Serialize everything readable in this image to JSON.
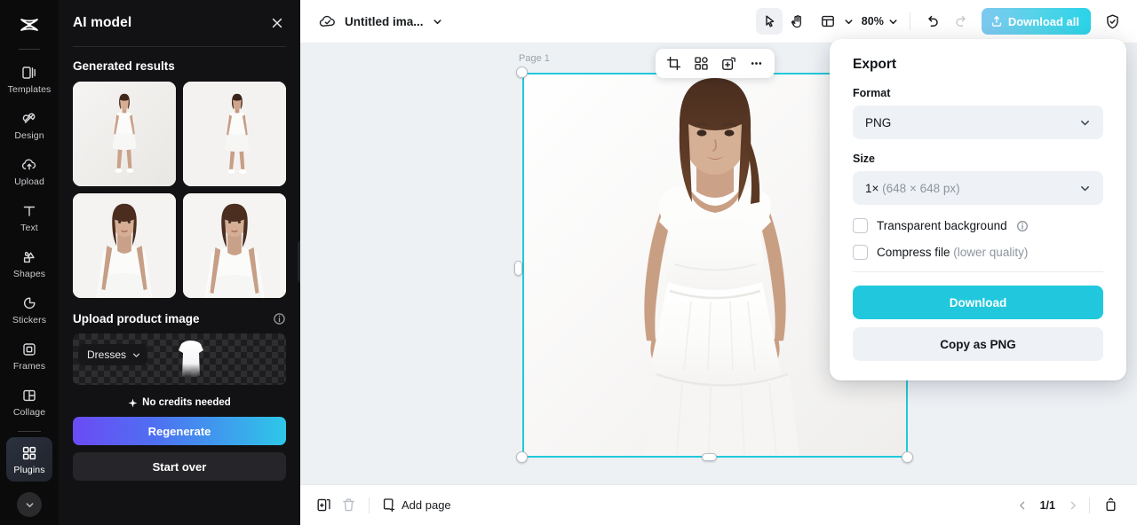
{
  "rail": {
    "logo_icon": "capcut-logo-icon",
    "items": [
      {
        "label": "Templates",
        "icon": "templates-icon",
        "active": false
      },
      {
        "label": "Design",
        "icon": "design-icon",
        "active": false
      },
      {
        "label": "Upload",
        "icon": "upload-cloud-icon",
        "active": false
      },
      {
        "label": "Text",
        "icon": "text-icon",
        "active": false
      },
      {
        "label": "Shapes",
        "icon": "shapes-icon",
        "active": false
      },
      {
        "label": "Stickers",
        "icon": "stickers-icon",
        "active": false
      },
      {
        "label": "Frames",
        "icon": "frames-icon",
        "active": false
      },
      {
        "label": "Collage",
        "icon": "collage-icon",
        "active": false
      },
      {
        "label": "Plugins",
        "icon": "plugins-icon",
        "active": true
      }
    ],
    "more_icon": "chevron-down-icon"
  },
  "panel": {
    "title": "AI model",
    "close_icon": "close-icon",
    "generated": {
      "heading": "Generated results",
      "count": 4
    },
    "upload": {
      "heading": "Upload product image",
      "info_icon": "info-icon",
      "category": "Dresses",
      "category_caret_icon": "chevron-down-icon"
    },
    "credits_text": "No credits needed",
    "credits_icon": "sparkle-icon",
    "regenerate_label": "Regenerate",
    "start_over_label": "Start over",
    "collapse_icon": "chevron-left-icon"
  },
  "topbar": {
    "cloud_icon": "cloud-saved-icon",
    "doc_name": "Untitled ima...",
    "doc_caret_icon": "chevron-down-icon",
    "select_tool_icon": "cursor-arrow-icon",
    "hand_tool_icon": "hand-icon",
    "layout_tool_icon": "layout-icon",
    "layout_caret_icon": "chevron-down-icon",
    "zoom_value": "80%",
    "zoom_caret_icon": "chevron-down-icon",
    "undo_icon": "undo-icon",
    "redo_icon": "redo-icon",
    "download_all_label": "Download all",
    "download_all_icon": "download-icon",
    "shield_icon": "shield-check-icon"
  },
  "canvas": {
    "page_label": "Page 1",
    "object_toolbar": [
      {
        "icon": "crop-icon"
      },
      {
        "icon": "remove-background-icon"
      },
      {
        "icon": "duplicate-icon"
      },
      {
        "icon": "more-horizontal-icon"
      }
    ]
  },
  "export": {
    "title": "Export",
    "format_label": "Format",
    "format_value": "PNG",
    "format_caret_icon": "chevron-down-icon",
    "size_label": "Size",
    "size_value_scale": "1×",
    "size_value_dims": "(648 × 648 px)",
    "size_caret_icon": "chevron-down-icon",
    "transparent_label": "Transparent background",
    "transparent_info_icon": "info-icon",
    "transparent_checked": false,
    "compress_label": "Compress file",
    "compress_hint": "(lower quality)",
    "compress_checked": false,
    "download_label": "Download",
    "copy_label": "Copy as PNG"
  },
  "bottombar": {
    "duplicate_page_icon": "duplicate-page-icon",
    "delete_page_icon": "trash-icon",
    "add_page_icon": "add-page-icon",
    "add_page_label": "Add page",
    "prev_icon": "chevron-left-icon",
    "page_indicator": "1/1",
    "next_icon": "chevron-right-icon",
    "grid_icon": "pages-grid-icon"
  },
  "annotation": {
    "arrow_color": "#e81c1c"
  },
  "colors": {
    "accent_cyan": "#21c8dd",
    "rail_bg": "#0b0b0c",
    "panel_bg": "#121214",
    "canvas_bg": "#edf1f4",
    "selection": "#21c8dd",
    "regenerate_gradient_from": "#6b4bf5",
    "regenerate_gradient_to": "#2ec7e8"
  }
}
